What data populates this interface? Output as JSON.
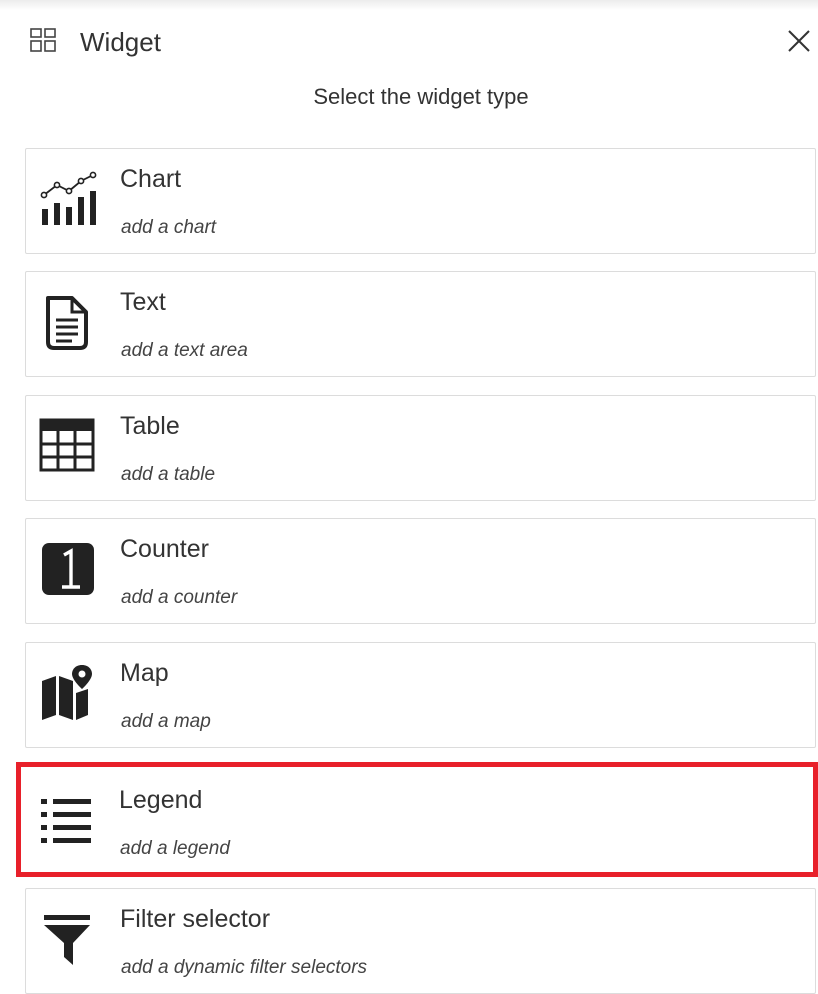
{
  "header": {
    "title": "Widget",
    "icon": "widget-grid-icon",
    "close_icon": "close-icon"
  },
  "subtitle": "Select the widget type",
  "widgets": [
    {
      "title": "Chart",
      "desc": "add a chart",
      "icon": "chart-icon"
    },
    {
      "title": "Text",
      "desc": "add a text area",
      "icon": "text-document-icon"
    },
    {
      "title": "Table",
      "desc": "add a table",
      "icon": "table-icon"
    },
    {
      "title": "Counter",
      "desc": "add a counter",
      "icon": "counter-icon"
    },
    {
      "title": "Map",
      "desc": "add a map",
      "icon": "map-icon"
    },
    {
      "title": "Legend",
      "desc": "add a legend",
      "icon": "list-icon",
      "highlighted": true
    },
    {
      "title": "Filter selector",
      "desc": "add a dynamic filter selectors",
      "icon": "filter-icon"
    }
  ],
  "colors": {
    "highlight": "#e8202a",
    "icon": "#222222",
    "card_border": "#dcdcdc"
  }
}
